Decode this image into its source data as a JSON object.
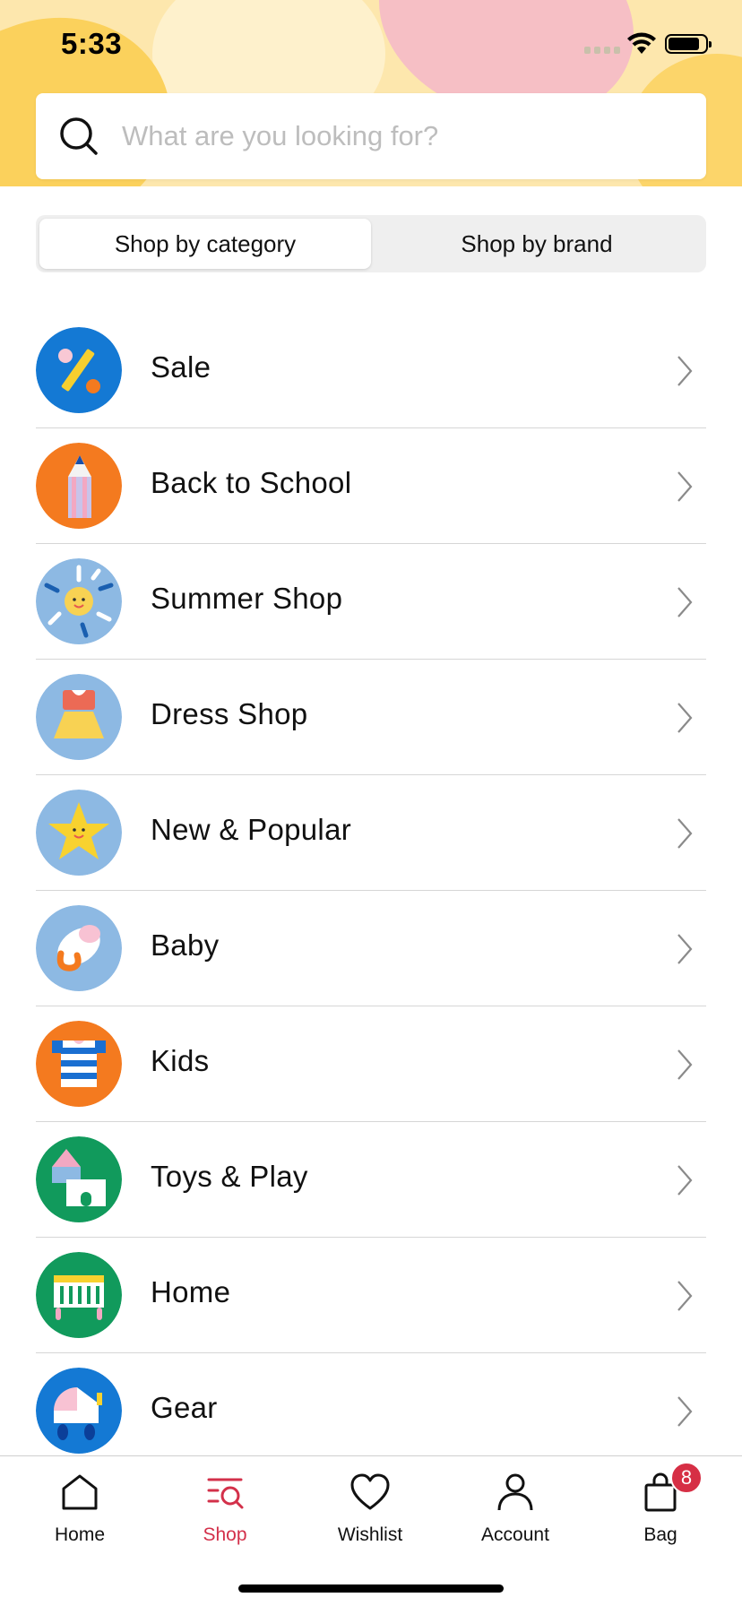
{
  "status_bar": {
    "time": "5:33"
  },
  "search": {
    "placeholder": "What are you looking for?"
  },
  "segments": [
    {
      "label": "Shop by category",
      "active": true
    },
    {
      "label": "Shop by brand",
      "active": false
    }
  ],
  "categories": [
    {
      "label": "Sale",
      "icon": "percent-icon",
      "color": "#1479d4"
    },
    {
      "label": "Back to School",
      "icon": "pencil-icon",
      "color": "#f47a1f"
    },
    {
      "label": "Summer Shop",
      "icon": "sun-icon",
      "color": "#8db9e3"
    },
    {
      "label": "Dress Shop",
      "icon": "dress-icon",
      "color": "#8db9e3"
    },
    {
      "label": "New & Popular",
      "icon": "star-icon",
      "color": "#8db9e3"
    },
    {
      "label": "Baby",
      "icon": "pacifier-icon",
      "color": "#8db9e3"
    },
    {
      "label": "Kids",
      "icon": "striped-shirt-icon",
      "color": "#f47a1f"
    },
    {
      "label": "Toys & Play",
      "icon": "blocks-icon",
      "color": "#119a5c"
    },
    {
      "label": "Home",
      "icon": "crib-icon",
      "color": "#119a5c"
    },
    {
      "label": "Gear",
      "icon": "stroller-icon",
      "color": "#1479d4"
    }
  ],
  "tabbar": {
    "home": "Home",
    "shop": "Shop",
    "wishlist": "Wishlist",
    "account": "Account",
    "bag": "Bag",
    "bag_count": "8",
    "active_color": "#d3304a"
  }
}
